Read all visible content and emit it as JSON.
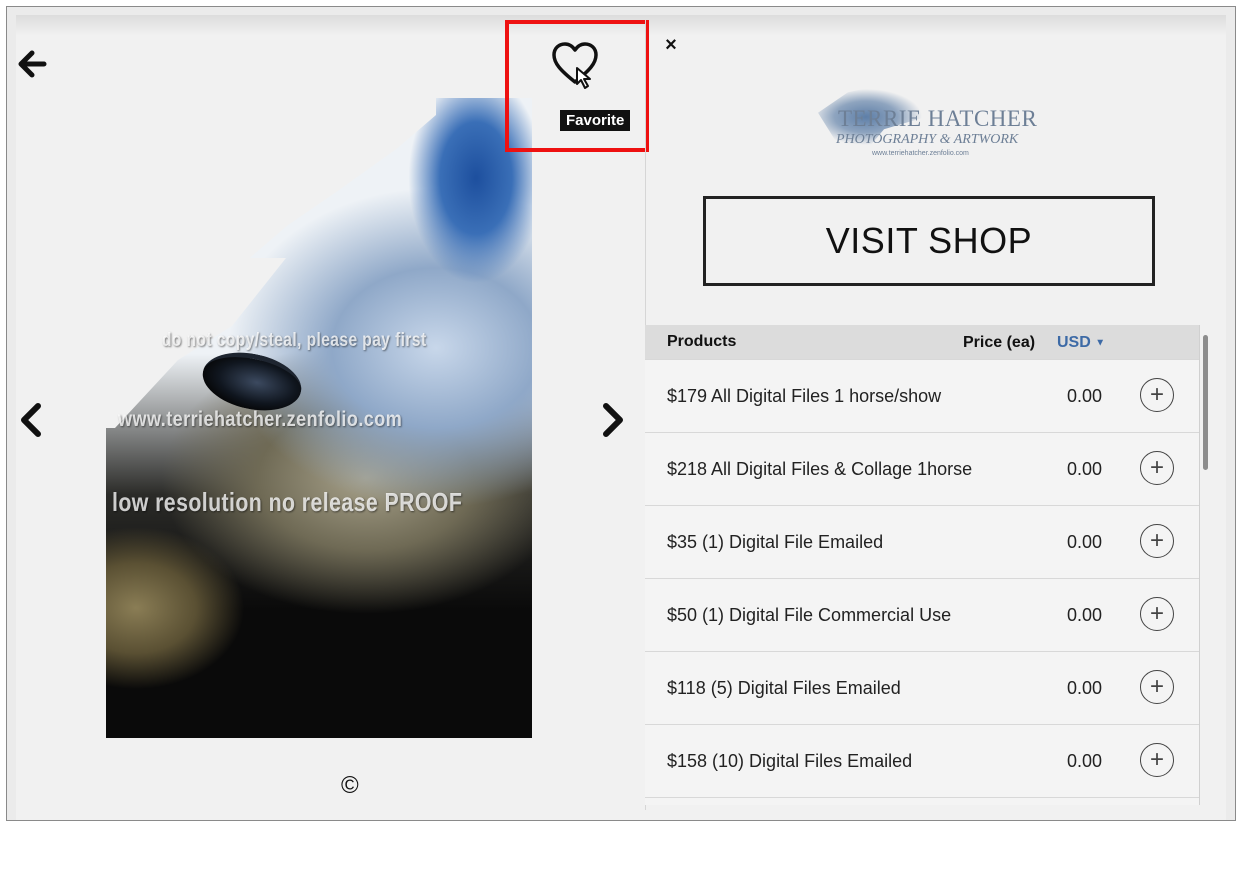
{
  "viewer": {
    "watermark_lines": [
      "do not copy/steal, please pay first",
      "www.terriehatcher.zenfolio.com",
      "low resolution no release PROOF"
    ],
    "copyright_symbol": "©",
    "favorite_tooltip": "Favorite",
    "close_glyph": "×"
  },
  "logo": {
    "line1": "TERRIE HATCHER",
    "line2": "PHOTOGRAPHY & ARTWORK",
    "line3": "www.terriehatcher.zenfolio.com"
  },
  "shop_button_label": "VISIT SHOP",
  "products": {
    "header_products": "Products",
    "header_price": "Price (ea)",
    "currency": "USD",
    "items": [
      {
        "name": "$179 All Digital Files 1 horse/show",
        "price": "0.00"
      },
      {
        "name": "$218 All Digital Files & Collage 1horse",
        "price": "0.00"
      },
      {
        "name": "$35 (1) Digital File Emailed",
        "price": "0.00"
      },
      {
        "name": "$50 (1) Digital File Commercial Use",
        "price": "0.00"
      },
      {
        "name": "$118 (5) Digital Files Emailed",
        "price": "0.00"
      },
      {
        "name": "$158 (10) Digital Files Emailed",
        "price": "0.00"
      }
    ]
  },
  "colors": {
    "highlight_box": "#ee1111",
    "currency_link": "#3d6aa6",
    "logo_text": "#6d7f96"
  }
}
